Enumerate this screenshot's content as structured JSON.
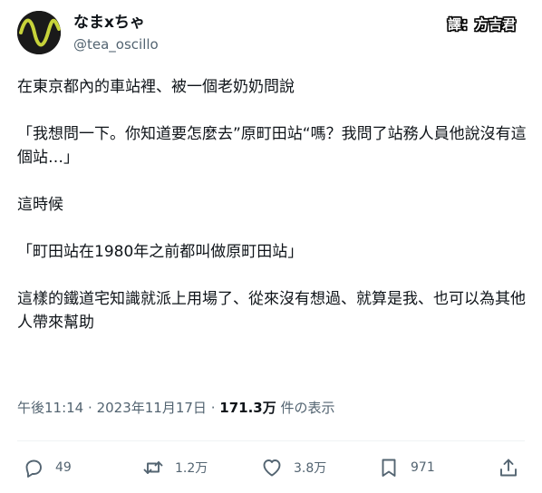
{
  "author": {
    "display_name": "なまxちゃ",
    "handle": "@tea_oscillo",
    "avatar_icon": "sine-wave-icon"
  },
  "translator_badge": "譯：方吉君",
  "tweet": {
    "paragraphs": [
      "在東京都內的車站裡、被一個老奶奶問說",
      "「我想問一下。你知道要怎麼去”原町田站“嗎？我問了站務人員他說沒有這個站…」",
      "這時候",
      "「町田站在1980年之前都叫做原町田站」",
      "這樣的鐵道宅知識就派上用場了、從來沒有想過、就算是我、也可以為其他人帶來幫助"
    ]
  },
  "meta": {
    "time": "午後11:14",
    "separator": "·",
    "date": "2023年11月17日",
    "views_count": "171.3万",
    "views_label": "件の表示"
  },
  "actions": {
    "reply": {
      "icon": "reply-icon",
      "count": "49"
    },
    "retweet": {
      "icon": "retweet-icon",
      "count": "1.2万"
    },
    "like": {
      "icon": "heart-icon",
      "count": "3.8万"
    },
    "bookmark": {
      "icon": "bookmark-icon",
      "count": "971"
    },
    "share": {
      "icon": "share-icon"
    }
  },
  "colors": {
    "text_primary": "#0f1419",
    "text_secondary": "#536471",
    "divider": "#eff3f4",
    "avatar_bg": "#1a1a1a",
    "avatar_wave": "#c7d33a"
  }
}
